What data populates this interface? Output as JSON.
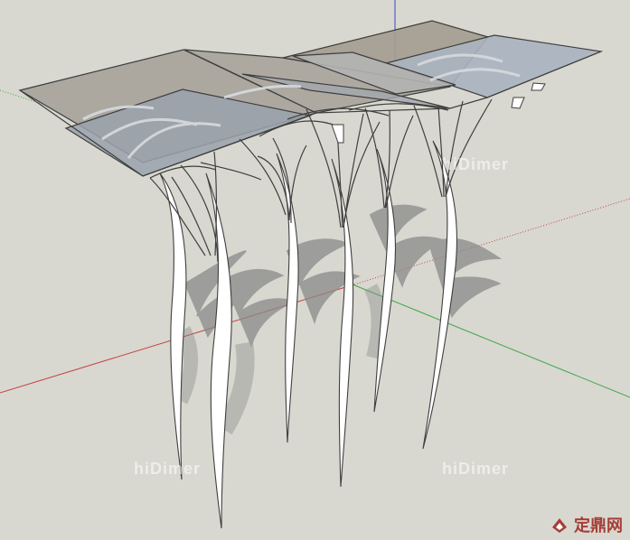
{
  "viewport": {
    "name": "3D model viewport",
    "background": "#d8d8d0"
  },
  "axes": {
    "red": "#c74343",
    "green": "#3fa84b",
    "blue": "#3d43c8"
  },
  "watermarks": {
    "top_right": "hiDimer",
    "bottom_left": "hiDimer",
    "bottom_right": "hiDimer"
  },
  "brand": {
    "text": "定鼎网"
  }
}
